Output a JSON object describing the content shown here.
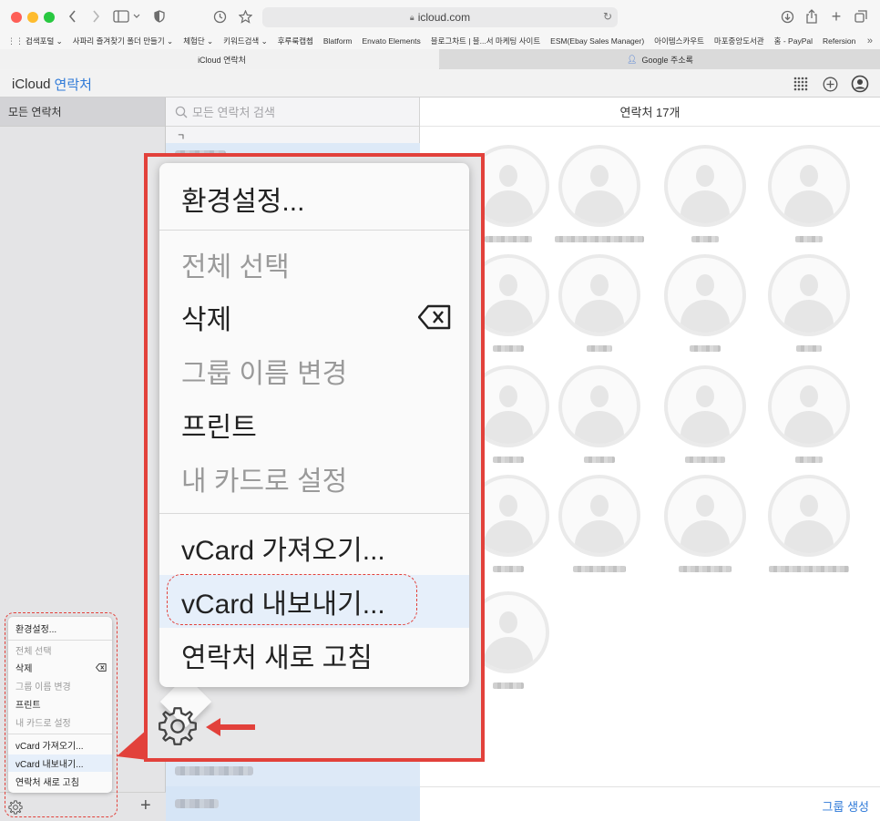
{
  "browser": {
    "url": "icloud.com",
    "bookmarks": [
      "검색포털 ⌄",
      "사파리 즐겨찾기 폴더 만들기 ⌄",
      "체험단 ⌄",
      "키워드검색 ⌄",
      "후루룩캡쳅",
      "Blatform",
      "Envato Elements",
      "블로그차트 | 블...서 마케팅 사이트",
      "ESM(Ebay Sales Manager)",
      "아이템스카우트",
      "마포중앙도서관",
      "홈 - PayPal",
      "Refersion"
    ],
    "tabs": [
      {
        "label": "iCloud 연락처",
        "favicon": "apple-icon"
      },
      {
        "label": "Google 주소록",
        "favicon": "person-icon"
      }
    ]
  },
  "app": {
    "brand": "iCloud",
    "name": "연락처",
    "accent_color": "#2f7ad8"
  },
  "groups": {
    "all_label": "모든 연락처"
  },
  "list": {
    "search_placeholder": "모든 연락처 검색",
    "index_letter": "ㄱ"
  },
  "grid": {
    "title": "연락처 17개",
    "new_group_label": "그룹 생성"
  },
  "menu": {
    "items": [
      {
        "label": "환경설정...",
        "enabled": true
      },
      {
        "label": "전체 선택",
        "enabled": false
      },
      {
        "label": "삭제",
        "enabled": true,
        "icon": "delete-key-icon"
      },
      {
        "label": "그룹 이름 변경",
        "enabled": false
      },
      {
        "label": "프린트",
        "enabled": true
      },
      {
        "label": "내 카드로 설정",
        "enabled": false
      },
      {
        "label": "vCard 가져오기...",
        "enabled": true
      },
      {
        "label": "vCard 내보내기...",
        "enabled": true,
        "highlighted": true
      },
      {
        "label": "연락처 새로 고침",
        "enabled": true
      }
    ]
  },
  "annotation": {
    "color": "#e2413b"
  }
}
